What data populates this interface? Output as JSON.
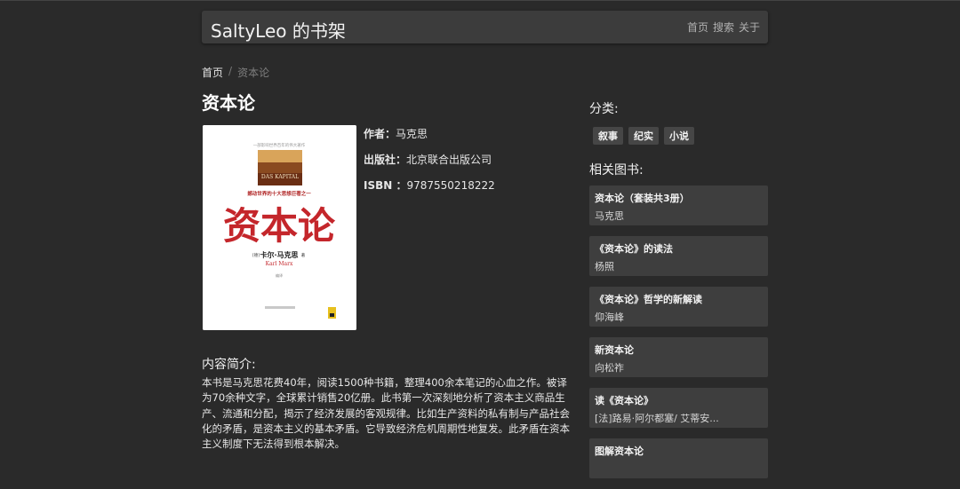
{
  "navbar": {
    "brand": "SaltyLeo 的书架",
    "links": [
      "首页",
      "搜索",
      "关于"
    ]
  },
  "breadcrumb": {
    "home": "首页",
    "separator": "/",
    "current": "资本论"
  },
  "book": {
    "title": "资本论",
    "cover": {
      "tagline_top": "一部影响世界百年的伟大著作",
      "banner": "DAS KAPITAL",
      "subtitle": "撼动世界的十大思想巨著之一",
      "big_title": "资本论",
      "author_cn": "卡尔·马克思",
      "author_prefix": "[德]",
      "author_suffix": "著",
      "author_en": "Karl Marx",
      "translator": "编译"
    },
    "meta": [
      {
        "key": "作者",
        "value": "马克思"
      },
      {
        "key": "出版社",
        "value": "北京联合出版公司"
      },
      {
        "key": "ISBN",
        "value": "9787550218222"
      }
    ],
    "intro_heading": "内容简介:",
    "intro": "本书是马克思花费40年，阅读1500种书籍，整理400余本笔记的心血之作。被译为70余种文字，全球累计销售20亿册。此书第一次深刻地分析了资本主义商品生产、流通和分配，揭示了经济发展的客观规律。比如生产资料的私有制与产品社会化的矛盾，是资本主义的基本矛盾。它导致经济危机周期性地复发。此矛盾在资本主义制度下无法得到根本解决。"
  },
  "sidebar": {
    "categories_heading": "分类:",
    "categories": [
      "叙事",
      "纪实",
      "小说"
    ],
    "related_heading": "相关图书:",
    "related": [
      {
        "title": "资本论（套装共3册）",
        "author": "马克思"
      },
      {
        "title": "《资本论》的读法",
        "author": "杨照"
      },
      {
        "title": "《资本论》哲学的新解读",
        "author": "仰海峰"
      },
      {
        "title": "新资本论",
        "author": "向松祚"
      },
      {
        "title": "读《资本论》",
        "author": "[法]路易·阿尔都塞/ 艾蒂安..."
      },
      {
        "title": "图解资本论",
        "author": ""
      }
    ]
  },
  "colors": {
    "background": "#2a2a2a",
    "panel": "#3c3c3c",
    "cover_red": "#c4262b"
  }
}
